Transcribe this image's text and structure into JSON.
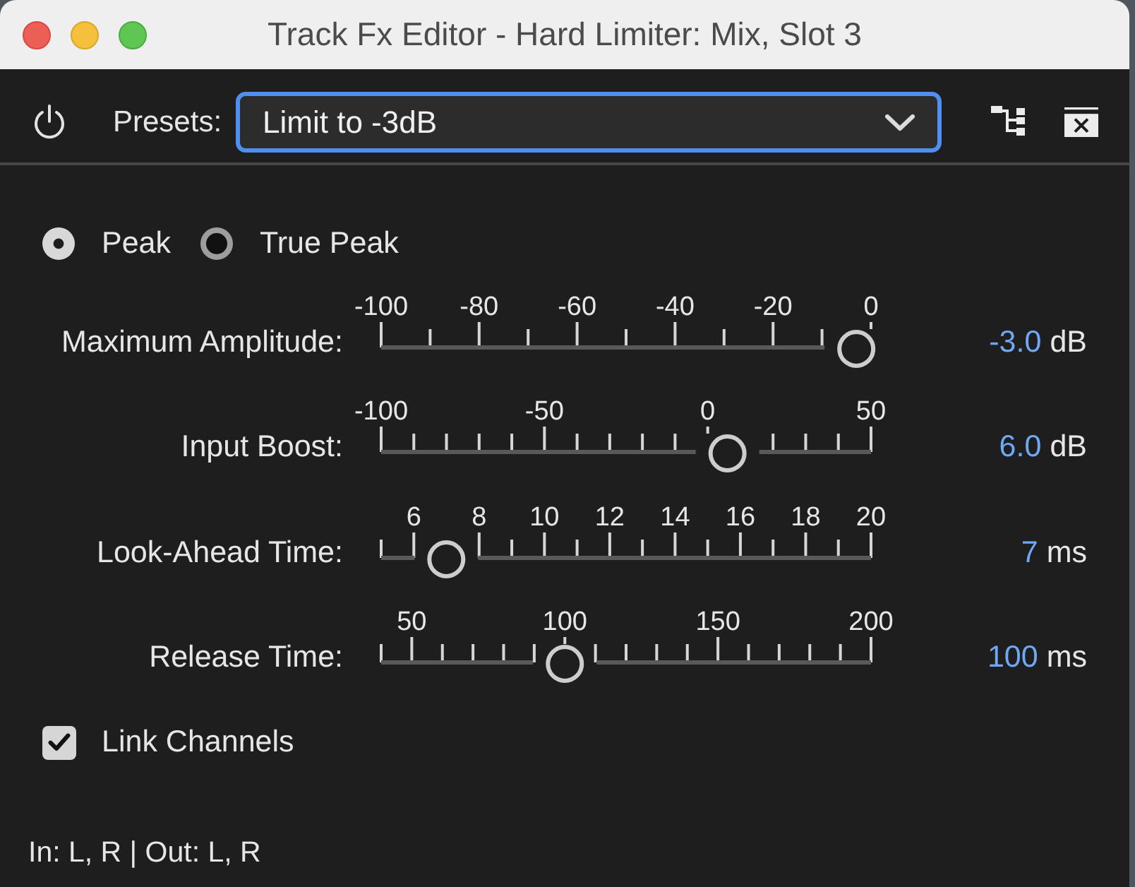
{
  "window": {
    "title": "Track Fx Editor - Hard Limiter: Mix, Slot 3"
  },
  "toolbar": {
    "presets_label": "Presets:",
    "preset": {
      "value": "Limit to -3dB",
      "focused": true
    }
  },
  "mode": [
    {
      "label": "Peak",
      "selected": true
    },
    {
      "label": "True Peak",
      "selected": false
    }
  ],
  "sliders": [
    {
      "label": "Maximum Amplitude:",
      "ticks": [
        {
          "major": true,
          "label": "-100"
        },
        {
          "major": false
        },
        {
          "major": true,
          "label": "-80"
        },
        {
          "major": false
        },
        {
          "major": true,
          "label": "-60"
        },
        {
          "major": false
        },
        {
          "major": true,
          "label": "-40"
        },
        {
          "major": false
        },
        {
          "major": true,
          "label": "-20"
        },
        {
          "major": false
        },
        {
          "major": true,
          "label": "0"
        }
      ],
      "level": 0.97,
      "value": "-3.0",
      "unit": "dB"
    },
    {
      "label": "Input Boost:",
      "ticks": [
        {
          "major": true,
          "label": "-100"
        },
        {
          "major": false
        },
        {
          "major": false
        },
        {
          "major": false
        },
        {
          "major": false
        },
        {
          "major": true,
          "label": "-50"
        },
        {
          "major": false
        },
        {
          "major": false
        },
        {
          "major": false
        },
        {
          "major": false
        },
        {
          "major": true,
          "label": "0"
        },
        {
          "major": false
        },
        {
          "major": false
        },
        {
          "major": false
        },
        {
          "major": false
        },
        {
          "major": true,
          "label": "50"
        }
      ],
      "level": 0.707,
      "value": "6.0",
      "unit": "dB"
    },
    {
      "label": "Look-Ahead Time:",
      "ticks": [
        {
          "major": false
        },
        {
          "major": true,
          "label": "6"
        },
        {
          "major": false
        },
        {
          "major": true,
          "label": "8"
        },
        {
          "major": false
        },
        {
          "major": true,
          "label": "10"
        },
        {
          "major": false
        },
        {
          "major": true,
          "label": "12"
        },
        {
          "major": false
        },
        {
          "major": true,
          "label": "14"
        },
        {
          "major": false
        },
        {
          "major": true,
          "label": "16"
        },
        {
          "major": false
        },
        {
          "major": true,
          "label": "18"
        },
        {
          "major": false
        },
        {
          "major": true,
          "label": "20"
        }
      ],
      "level": 0.133,
      "value": "7",
      "unit": "ms"
    },
    {
      "label": "Release Time:",
      "ticks": [
        {
          "major": false
        },
        {
          "major": true,
          "label": "50"
        },
        {
          "major": false
        },
        {
          "major": false
        },
        {
          "major": false
        },
        {
          "major": false
        },
        {
          "major": true,
          "label": "100"
        },
        {
          "major": false
        },
        {
          "major": false
        },
        {
          "major": false
        },
        {
          "major": false
        },
        {
          "major": true,
          "label": "150"
        },
        {
          "major": false
        },
        {
          "major": false
        },
        {
          "major": false
        },
        {
          "major": false
        },
        {
          "major": true,
          "label": "200"
        }
      ],
      "level": 0.375,
      "value": "100",
      "unit": "ms"
    }
  ],
  "link_channels": {
    "label": "Link Channels",
    "checked": true
  },
  "status_bar": {
    "text": "In: L, R | Out: L, R"
  }
}
